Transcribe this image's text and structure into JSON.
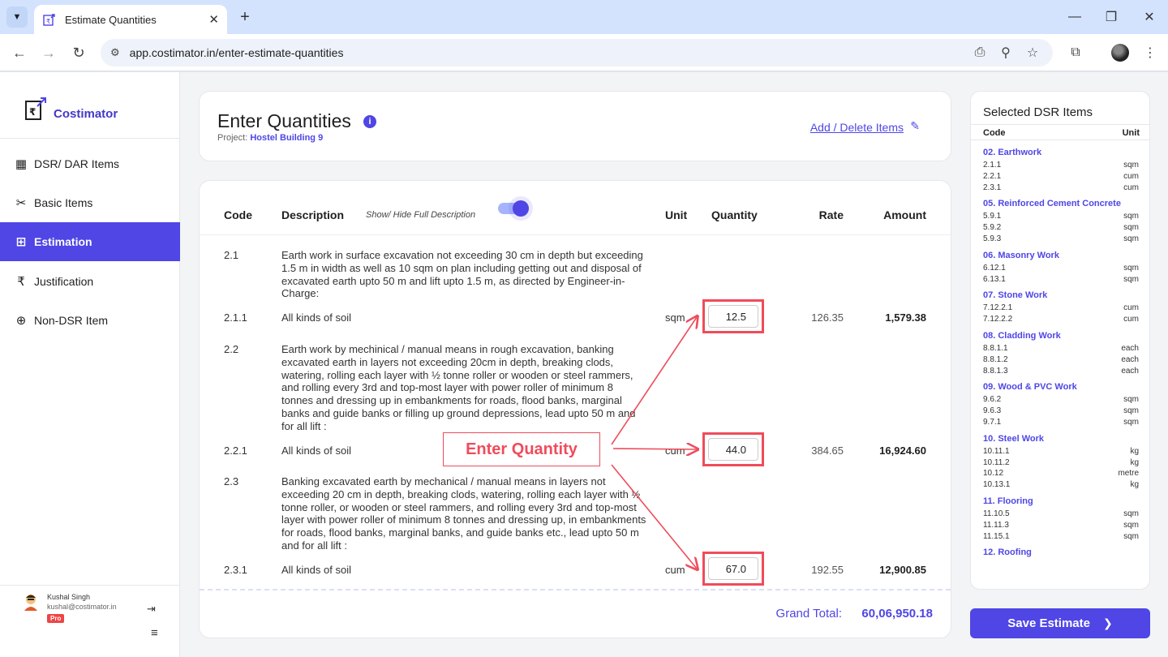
{
  "browser": {
    "tab_title": "Estimate Quantities",
    "url": "app.costimator.in/enter-estimate-quantities"
  },
  "sidebar": {
    "brand": "Costimator",
    "items": [
      {
        "label": "DSR/ DAR Items",
        "icon": "table-icon"
      },
      {
        "label": "Basic Items",
        "icon": "tools-icon"
      },
      {
        "label": "Estimation",
        "icon": "grid-icon",
        "active": true
      },
      {
        "label": "Justification",
        "icon": "rupee-icon"
      },
      {
        "label": "Non-DSR Item",
        "icon": "add-box-icon"
      }
    ],
    "user": {
      "name": "Kushal Singh",
      "email": "kushal@costimator.in",
      "badge": "Pro"
    }
  },
  "header": {
    "title": "Enter Quantities",
    "project_label": "Project:",
    "project_name": "Hostel Building 9",
    "add_delete_link": "Add / Delete Items"
  },
  "table": {
    "columns": {
      "code": "Code",
      "description": "Description",
      "unit": "Unit",
      "quantity": "Quantity",
      "rate": "Rate",
      "amount": "Amount"
    },
    "toggle_label": "Show/ Hide Full Description",
    "toggle_on": true,
    "rows": [
      {
        "code": "2.1",
        "description": "Earth work in surface excavation not exceeding 30 cm in depth but exceeding 1.5 m in width as well as 10 sqm on plan including getting out and disposal of excavated earth upto 50 m and lift upto 1.5 m, as directed by Engineer-in- Charge:"
      },
      {
        "code": "2.1.1",
        "description": "All kinds of soil",
        "unit": "sqm",
        "quantity": "12.5",
        "rate": "126.35",
        "amount": "1,579.38"
      },
      {
        "code": "2.2",
        "description": "Earth work by mechinical / manual means in rough excavation, banking excavated earth in layers not exceeding 20cm in depth, breaking clods, watering, rolling each layer with ½ tonne roller or wooden or steel rammers, and rolling every 3rd and top-most layer with power roller of minimum 8 tonnes and dressing up in embankments for roads, flood banks, marginal banks and guide banks or filling up ground depressions, lead upto 50 m and for all lift  :"
      },
      {
        "code": "2.2.1",
        "description": "All kinds of soil",
        "unit": "cum",
        "quantity": "44.0",
        "rate": "384.65",
        "amount": "16,924.60"
      },
      {
        "code": "2.3",
        "description": "Banking excavated earth by mechanical / manual means in layers not exceeding 20 cm in depth, breaking clods, watering, rolling each layer with ½ tonne roller, or wooden or steel rammers, and rolling every 3rd and top-most layer with power roller of minimum 8 tonnes and dressing up, in embankments for roads, flood banks, marginal banks, and guide banks etc., lead upto 50 m and for all lift :"
      },
      {
        "code": "2.3.1",
        "description": "All kinds of soil",
        "unit": "cum",
        "quantity": "67.0",
        "rate": "192.55",
        "amount": "12,900.85"
      }
    ],
    "grand_total_label": "Grand Total:",
    "grand_total_value": "60,06,950.18"
  },
  "annotation": {
    "label": "Enter Quantity",
    "color": "#ef4c5b"
  },
  "right_panel": {
    "title": "Selected DSR Items",
    "col_code": "Code",
    "col_unit": "Unit",
    "groups": [
      {
        "title": "02. Earthwork",
        "items": [
          [
            "2.1.1",
            "sqm"
          ],
          [
            "2.2.1",
            "cum"
          ],
          [
            "2.3.1",
            "cum"
          ]
        ]
      },
      {
        "title": "05. Reinforced Cement Concrete",
        "items": [
          [
            "5.9.1",
            "sqm"
          ],
          [
            "5.9.2",
            "sqm"
          ],
          [
            "5.9.3",
            "sqm"
          ]
        ]
      },
      {
        "title": "06. Masonry Work",
        "items": [
          [
            "6.12.1",
            "sqm"
          ],
          [
            "6.13.1",
            "sqm"
          ]
        ]
      },
      {
        "title": "07. Stone Work",
        "items": [
          [
            "7.12.2.1",
            "cum"
          ],
          [
            "7.12.2.2",
            "cum"
          ]
        ]
      },
      {
        "title": "08. Cladding Work",
        "items": [
          [
            "8.8.1.1",
            "each"
          ],
          [
            "8.8.1.2",
            "each"
          ],
          [
            "8.8.1.3",
            "each"
          ]
        ]
      },
      {
        "title": "09. Wood & PVC Work",
        "items": [
          [
            "9.6.2",
            "sqm"
          ],
          [
            "9.6.3",
            "sqm"
          ],
          [
            "9.7.1",
            "sqm"
          ]
        ]
      },
      {
        "title": "10. Steel Work",
        "items": [
          [
            "10.11.1",
            "kg"
          ],
          [
            "10.11.2",
            "kg"
          ],
          [
            "10.12",
            "metre"
          ],
          [
            "10.13.1",
            "kg"
          ]
        ]
      },
      {
        "title": "11. Flooring",
        "items": [
          [
            "11.10.5",
            "sqm"
          ],
          [
            "11.11.3",
            "sqm"
          ],
          [
            "11.15.1",
            "sqm"
          ]
        ]
      },
      {
        "title": "12. Roofing",
        "items": []
      }
    ]
  },
  "save_button": "Save Estimate",
  "colors": {
    "accent": "#4f46e5",
    "annotation": "#ef4c5b"
  }
}
